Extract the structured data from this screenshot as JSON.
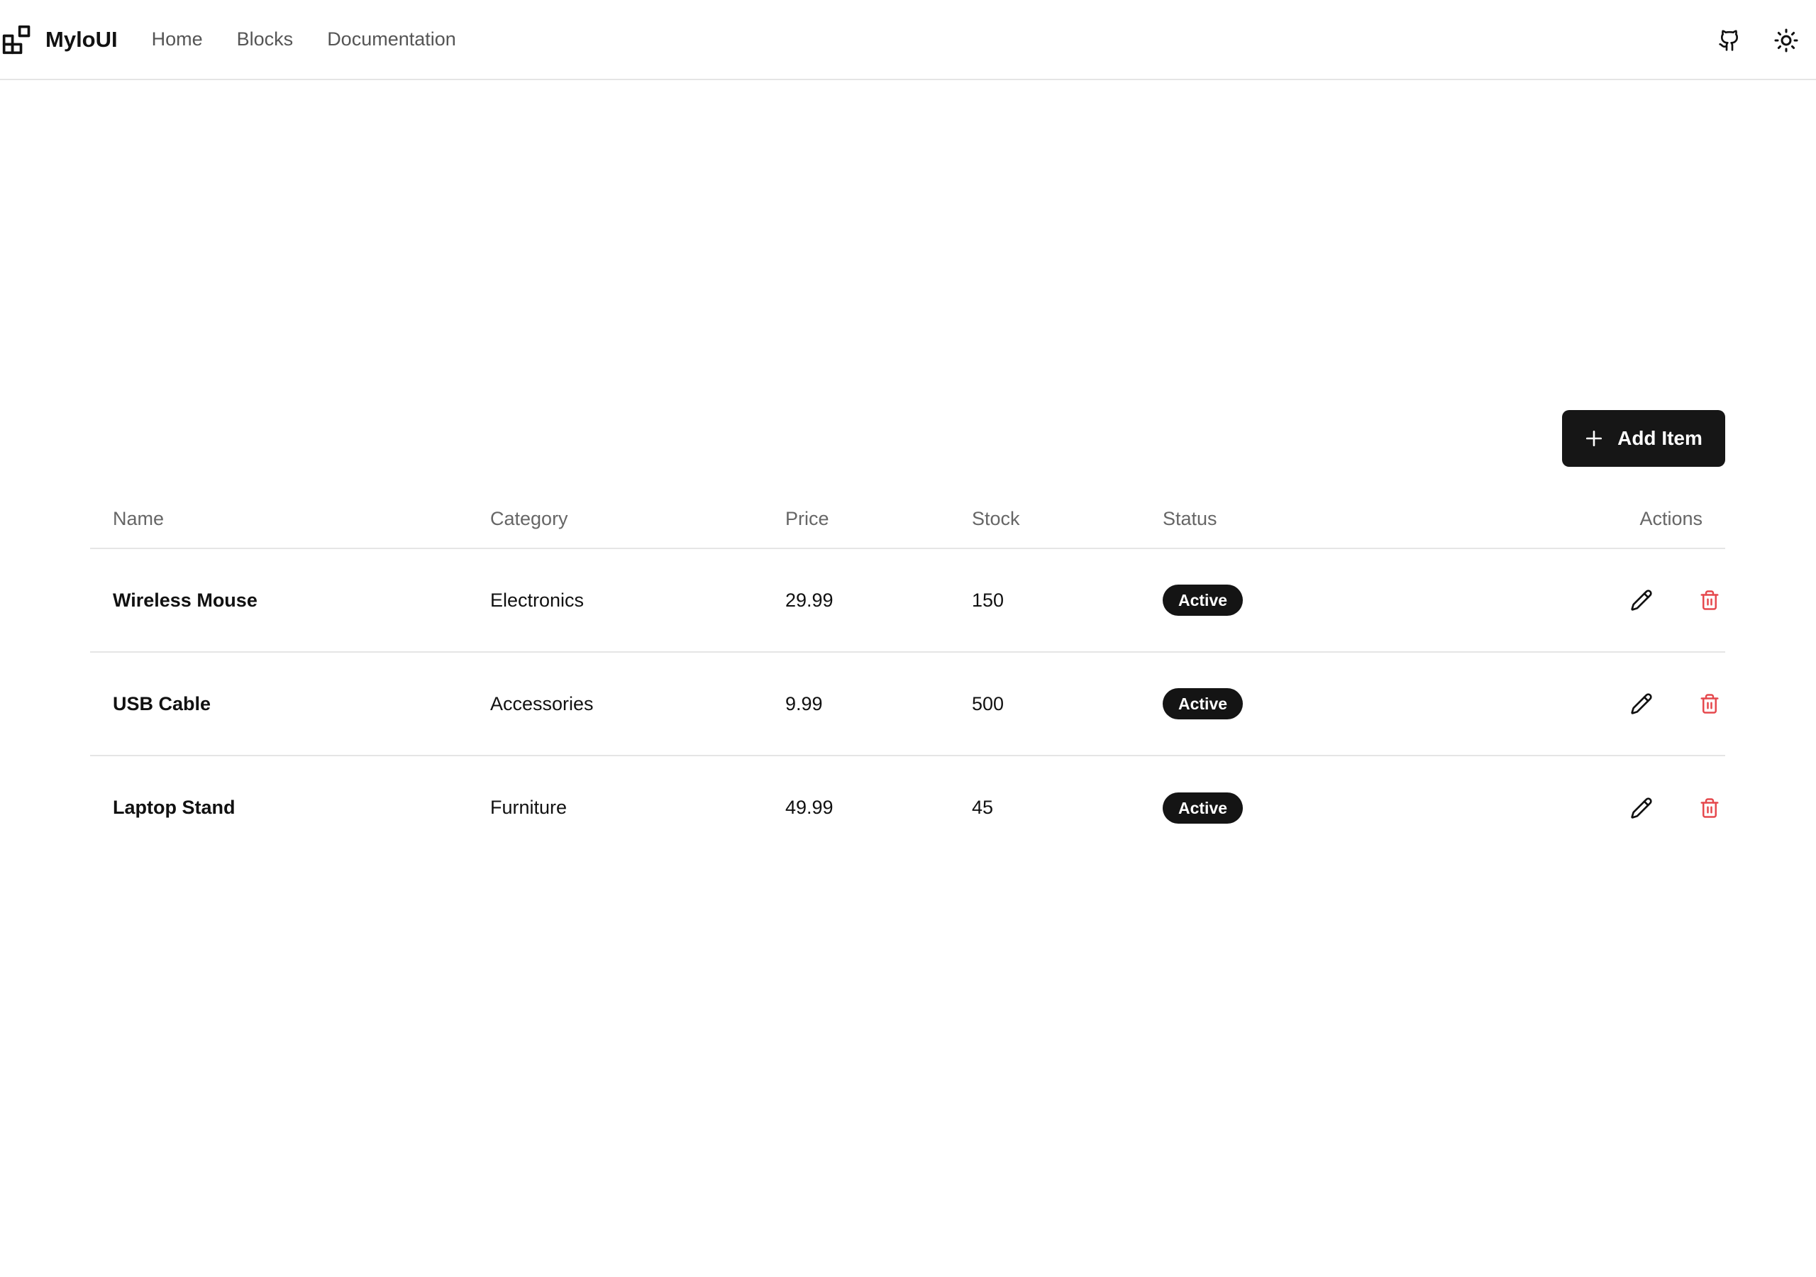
{
  "header": {
    "brand": "MyloUI",
    "nav": [
      {
        "label": "Home"
      },
      {
        "label": "Blocks"
      },
      {
        "label": "Documentation"
      }
    ],
    "icons": {
      "logo": "blocks-icon",
      "github": "github-icon",
      "theme": "sun-icon"
    }
  },
  "toolbar": {
    "add_label": "Add Item",
    "add_icon": "plus-icon"
  },
  "table": {
    "columns": [
      "Name",
      "Category",
      "Price",
      "Stock",
      "Status",
      "Actions"
    ],
    "rows": [
      {
        "name": "Wireless Mouse",
        "category": "Electronics",
        "price": "29.99",
        "stock": "150",
        "status": "Active"
      },
      {
        "name": "USB Cable",
        "category": "Accessories",
        "price": "9.99",
        "stock": "500",
        "status": "Active"
      },
      {
        "name": "Laptop Stand",
        "category": "Furniture",
        "price": "49.99",
        "stock": "45",
        "status": "Active"
      }
    ],
    "action_icons": {
      "edit": "pencil-icon",
      "delete": "trash-icon"
    }
  },
  "colors": {
    "primary": "#161616",
    "danger": "#e5484d",
    "muted_text": "#666666",
    "border": "#e5e5e5"
  }
}
